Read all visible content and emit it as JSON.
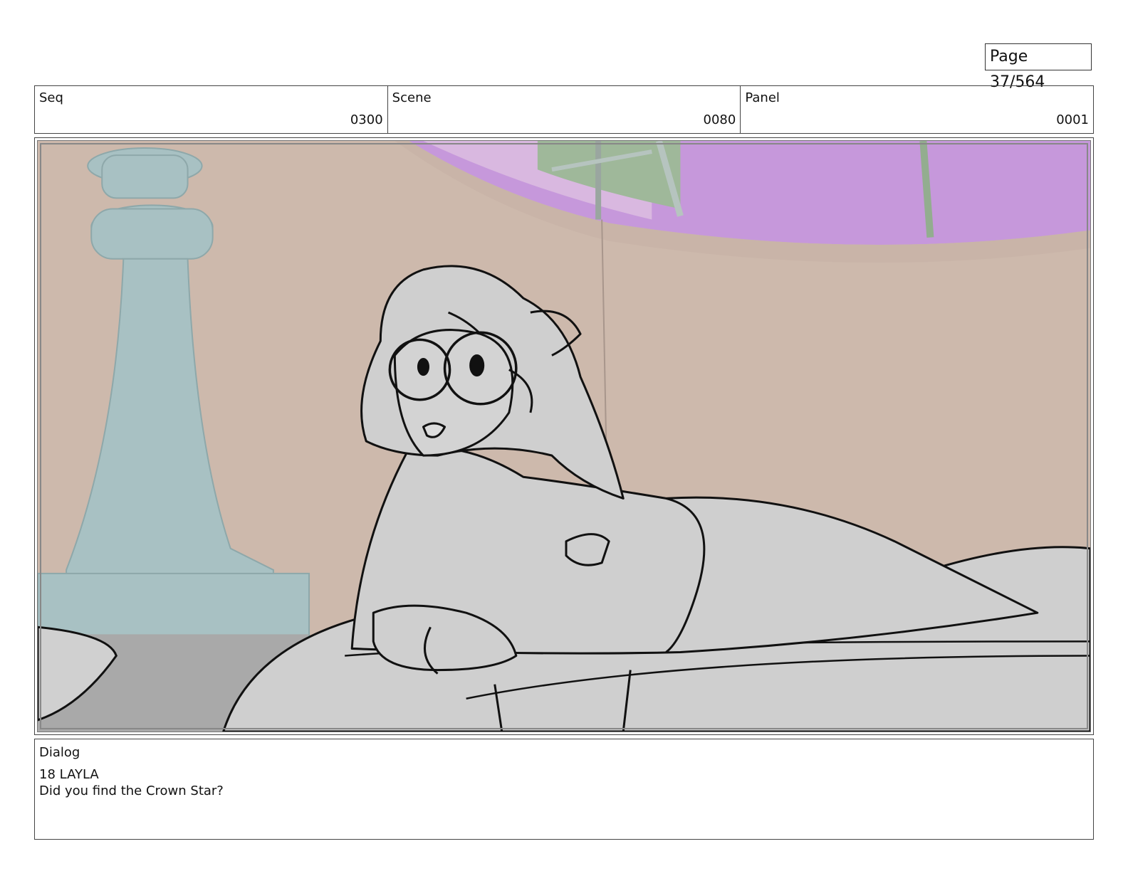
{
  "page": {
    "label": "Page",
    "number": "37/564"
  },
  "header": {
    "seq": {
      "label": "Seq",
      "value": "0300"
    },
    "scene": {
      "label": "Scene",
      "value": "0080"
    },
    "panel": {
      "label": "Panel",
      "value": "0001"
    }
  },
  "frame": {
    "description_icons": [
      "chess-king-pillar",
      "round-window",
      "bed",
      "character-sketch"
    ],
    "colors": {
      "wall": "#cdb9ac",
      "window_glass": "#c698db",
      "pillar": "#a8c1c3",
      "sketch_fill": "#cfcfcf",
      "floor": "#a9a9a9"
    }
  },
  "dialog": {
    "label": "Dialog",
    "speaker": "18 LAYLA",
    "line": "Did you find the Crown Star?"
  }
}
